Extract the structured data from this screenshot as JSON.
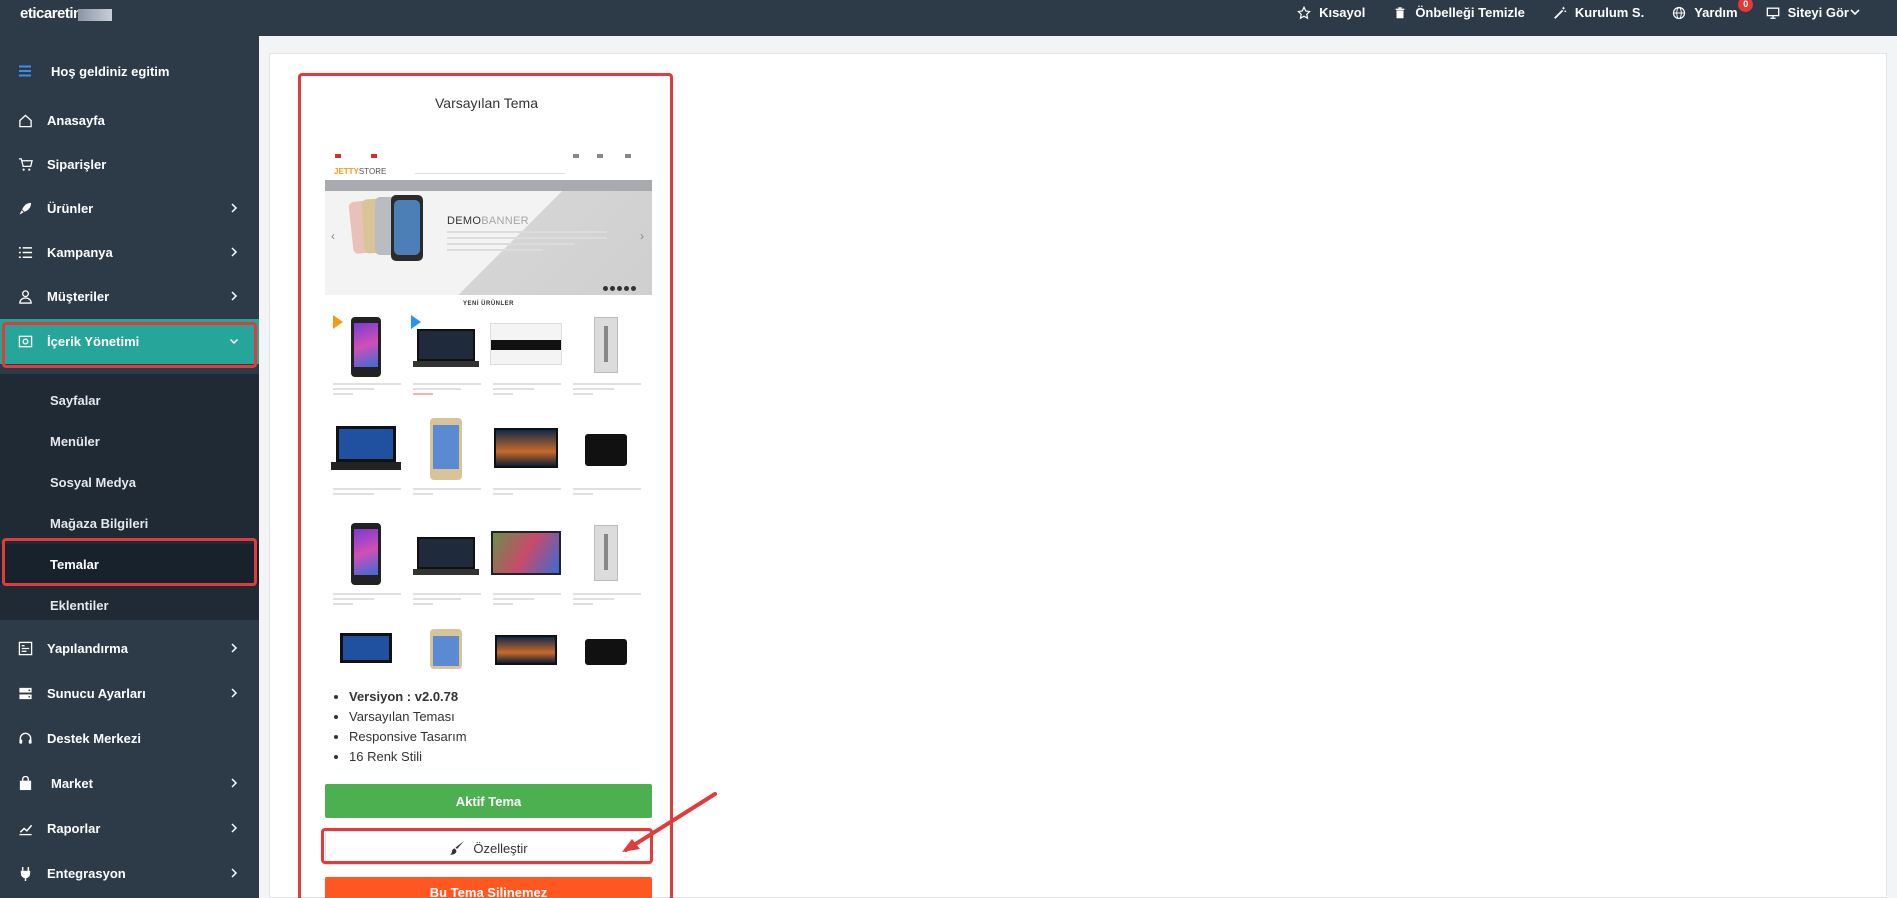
{
  "header": {
    "logo_text": "eticaretin",
    "items": [
      {
        "label": "Kısayol",
        "icon": "star-icon"
      },
      {
        "label": "Önbelleği Temizle",
        "icon": "trash-icon"
      },
      {
        "label": "Kurulum S.",
        "icon": "magic-wand-icon"
      },
      {
        "label": "Yardım",
        "icon": "globe-icon",
        "badge": "0"
      },
      {
        "label": "Siteyi Gör",
        "icon": "monitor-icon"
      }
    ]
  },
  "sidebar": {
    "welcome": "Hoş geldiniz egitim",
    "items": [
      {
        "label": "Anasayfa",
        "icon": "home-icon",
        "has_children": false
      },
      {
        "label": "Siparişler",
        "icon": "cart-icon",
        "has_children": false
      },
      {
        "label": "Ürünler",
        "icon": "rocket-icon",
        "has_children": true
      },
      {
        "label": "Kampanya",
        "icon": "list-icon",
        "has_children": true
      },
      {
        "label": "Müşteriler",
        "icon": "user-icon",
        "has_children": true
      },
      {
        "label": "İçerik Yönetimi",
        "icon": "content-icon",
        "has_children": true,
        "active": true
      },
      {
        "label": "Yapılandırma",
        "icon": "config-icon",
        "has_children": true
      },
      {
        "label": "Sunucu Ayarları",
        "icon": "server-icon",
        "has_children": true
      },
      {
        "label": "Destek Merkezi",
        "icon": "headset-icon",
        "has_children": false
      },
      {
        "label": "Market",
        "icon": "bag-icon",
        "has_children": true
      },
      {
        "label": "Raporlar",
        "icon": "chart-icon",
        "has_children": true
      },
      {
        "label": "Entegrasyon",
        "icon": "plug-icon",
        "has_children": true
      }
    ],
    "submenu": [
      {
        "label": "Sayfalar"
      },
      {
        "label": "Menüler"
      },
      {
        "label": "Sosyal Medya"
      },
      {
        "label": "Mağaza Bilgileri"
      },
      {
        "label": "Temalar",
        "current": true
      },
      {
        "label": "Eklentiler"
      }
    ]
  },
  "theme_card": {
    "title": "Varsayılan Tema",
    "preview": {
      "logo": "JETTY",
      "logo_suffix": "STORE",
      "banner_title": "DEMO",
      "banner_title_suffix": "BANNER",
      "section_title": "YENİ ÜRÜNLER"
    },
    "features": [
      "Versiyon : v2.0.78",
      "Varsayılan Teması",
      "Responsive Tasarım",
      "16 Renk Stili"
    ],
    "buttons": {
      "active": "Aktif Tema",
      "customize": "Özelleştir",
      "delete": "Bu Tema Silinemez"
    }
  },
  "colors": {
    "sidebar_bg": "#2d3a48",
    "active_green_teal": "#26a69a",
    "active_button": "#4caf50",
    "delete_button": "#ff5722",
    "highlight": "#e23b3b"
  }
}
